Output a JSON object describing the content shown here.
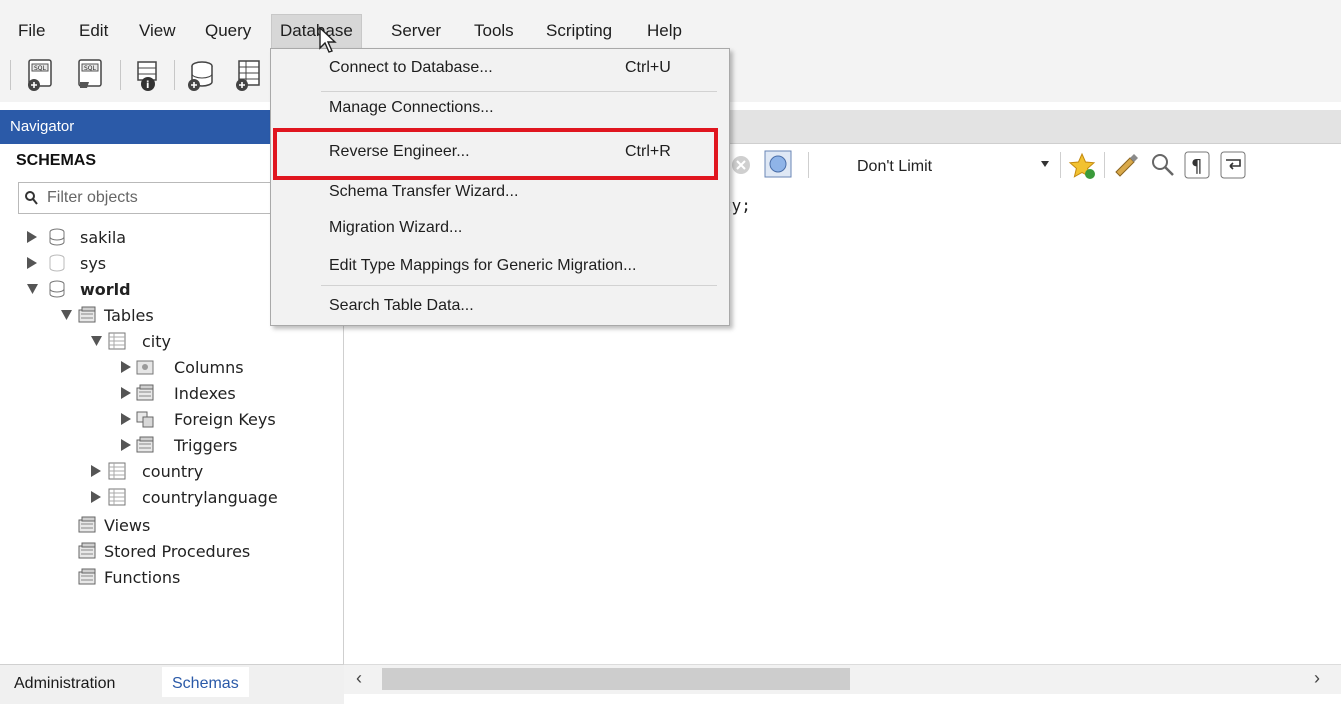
{
  "menu": {
    "items": [
      "File",
      "Edit",
      "View",
      "Query",
      "Database",
      "Server",
      "Tools",
      "Scripting",
      "Help"
    ]
  },
  "navigator": {
    "header": "Navigator",
    "schemas_title": "SCHEMAS",
    "filter_placeholder": "Filter objects",
    "tree": {
      "sakila": "sakila",
      "sys": "sys",
      "world": "world",
      "tables": "Tables",
      "city": "city",
      "columns": "Columns",
      "indexes": "Indexes",
      "foreign_keys": "Foreign Keys",
      "triggers": "Triggers",
      "country": "country",
      "countrylanguage": "countrylanguage",
      "views": "Views",
      "stored_procedures": "Stored Procedures",
      "functions": "Functions"
    },
    "bottom_tabs": {
      "administration": "Administration",
      "schemas": "Schemas"
    }
  },
  "editor": {
    "limit_value": "Don't Limit",
    "code_fragment": "ty;"
  },
  "database_menu": {
    "connect": {
      "label": "Connect to Database...",
      "shortcut": "Ctrl+U"
    },
    "manage": {
      "label": "Manage Connections..."
    },
    "reverse": {
      "label": "Reverse Engineer...",
      "shortcut": "Ctrl+R"
    },
    "transfer": {
      "label": "Schema Transfer Wizard..."
    },
    "migration": {
      "label": "Migration Wizard..."
    },
    "type_mappings": {
      "label": "Edit Type Mappings for Generic Migration..."
    },
    "search": {
      "label": "Search Table Data..."
    }
  },
  "colors": {
    "navigator_header": "#2b5aa8",
    "highlight_box": "#e0161f"
  }
}
